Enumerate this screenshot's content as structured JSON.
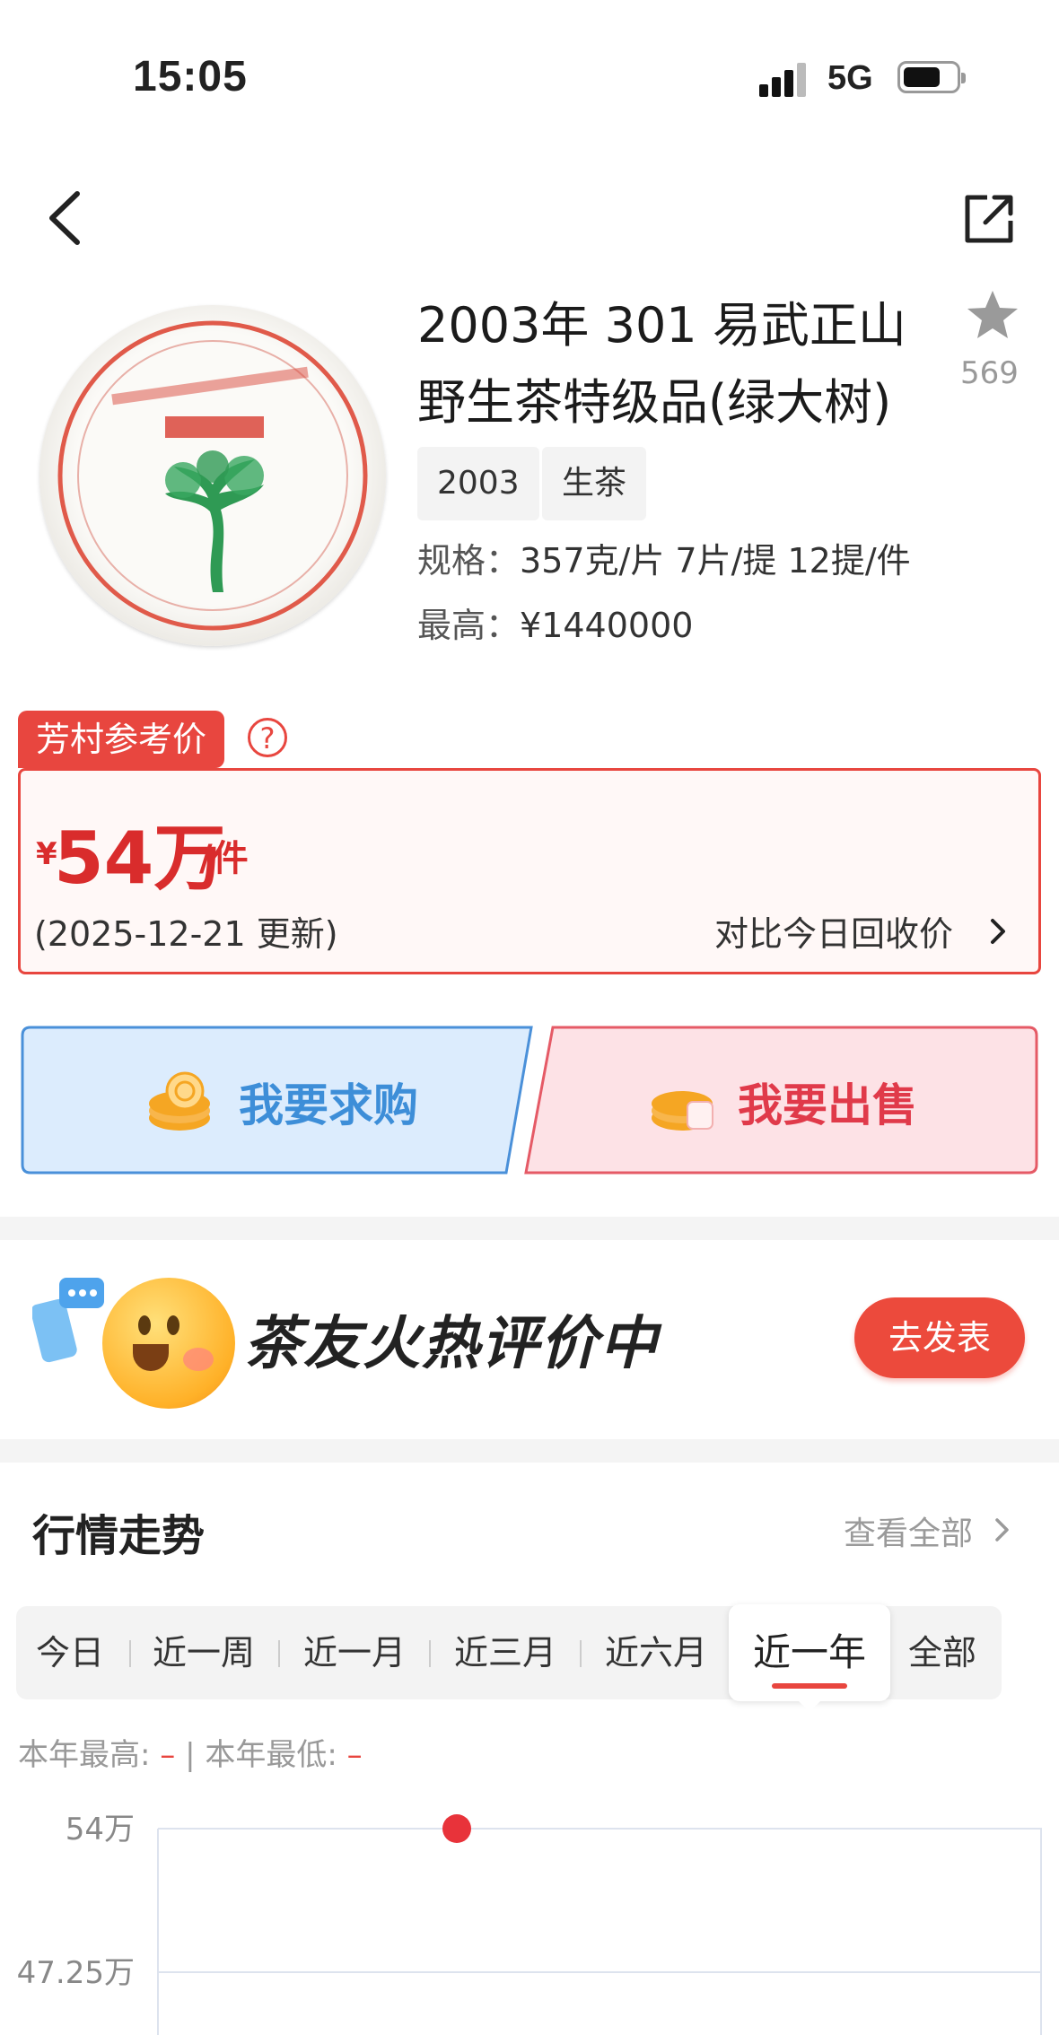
{
  "status_bar": {
    "time": "15:05",
    "network": "5G"
  },
  "product": {
    "title_line1": "2003年 301 易武正山",
    "title_line2": "野生茶特级品(绿大树)",
    "favorite_count": "569",
    "tags": [
      "2003",
      "生茶"
    ],
    "spec_label": "规格：",
    "spec_value": "357克/片 7片/提 12提/件",
    "max_label": "最高：",
    "max_value": "¥1440000"
  },
  "reference": {
    "tag": "芳村参考价",
    "help": "?",
    "currency": "¥",
    "price": "54万",
    "unit": "/件",
    "updated": "(2025-12-21 更新)",
    "compare_link": "对比今日回收价"
  },
  "actions": {
    "buy": "我要求购",
    "sell": "我要出售"
  },
  "review_banner": {
    "slogan": "茶友火热评价中",
    "button": "去发表"
  },
  "market": {
    "title": "行情走势",
    "view_all": "查看全部",
    "tabs": [
      "今日",
      "近一周",
      "近一月",
      "近三月",
      "近六月",
      "近一年",
      "全部"
    ],
    "active_tab": "近一年",
    "year_high_label": "本年最高:",
    "year_high_value": "–",
    "year_separator": "|",
    "year_low_label": "本年最低:",
    "year_low_value": "–"
  },
  "chart_data": {
    "type": "line",
    "y_ticks": [
      "54万",
      "47.25万"
    ],
    "points": [
      {
        "x": 0.5,
        "y": 54
      }
    ],
    "ylim": [
      47.25,
      54
    ],
    "grid": true,
    "colors": {
      "point": "#e8333a",
      "grid": "#dde3ee"
    }
  },
  "colors": {
    "accent": "#e8463f",
    "price": "#d92c2c",
    "buy": "#3d8ed8",
    "sell": "#e03a4a"
  },
  "icons": [
    "back-icon",
    "share-icon",
    "star-icon",
    "help-icon",
    "chevron-right-icon",
    "coin-icon",
    "chat-bubble-icon",
    "smiley-icon"
  ]
}
